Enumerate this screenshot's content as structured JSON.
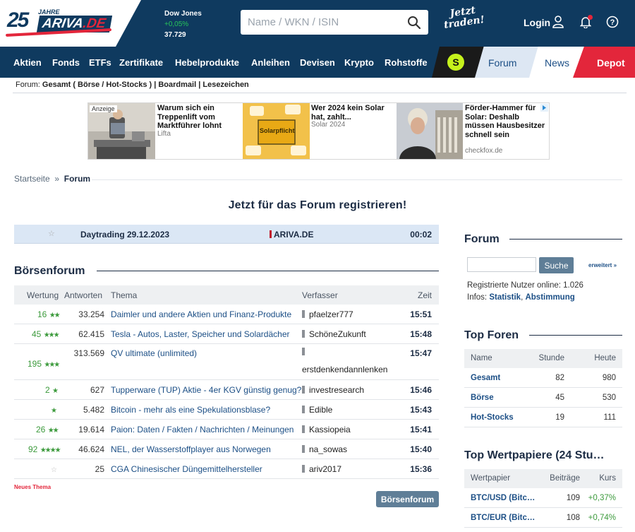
{
  "header": {
    "logo_num": "25",
    "logo_jahre": "JAHRE",
    "logo_ariva": "ARIVA",
    "logo_de": ".DE",
    "ticker": {
      "name": "Dow Jones",
      "change": "+0,05%",
      "value": "37.729"
    },
    "search_placeholder": "Name / WKN / ISIN",
    "traden_1": "Jetzt",
    "traden_2": "traden!",
    "login": "Login"
  },
  "nav": {
    "items": [
      "Aktien",
      "Fonds",
      "ETFs",
      "Zertifikate",
      "Hebelprodukte",
      "Anleihen",
      "Devisen",
      "Krypto",
      "Rohstoffe"
    ],
    "s_logo": "S",
    "forum": "Forum",
    "news": "News",
    "depot": "Depot"
  },
  "subnav": {
    "prefix": "Forum: ",
    "gesamt": "Gesamt",
    "paren": " ( Börse / Hot-Stocks ) | ",
    "boardmail": "Boardmail",
    "sep": " | ",
    "lesezeichen": "Lesezeichen"
  },
  "ads": {
    "label": "Anzeige",
    "items": [
      {
        "title": "Warum sich ein Treppenlift vom Marktführer lohnt",
        "source": "Lifta"
      },
      {
        "title": "Wer 2024 kein Solar hat, zahlt...",
        "source": "Solar 2024",
        "sign": "Solarpflicht"
      },
      {
        "title": "Förder-Hammer für Solar: Deshalb müssen Hausbesitzer schnell sein",
        "source": "checkfox.de"
      }
    ]
  },
  "breadcrumb": {
    "home": "Startseite",
    "sep": "»",
    "current": "Forum"
  },
  "register": "Jetzt für das Forum registrieren!",
  "featured": {
    "title": "Daytrading 29.12.2023",
    "source": "ARIVA.DE",
    "time": "00:02"
  },
  "boersenforum": {
    "title": "Börsenforum",
    "columns": {
      "rating": "Wertung",
      "answers": "Antworten",
      "topic": "Thema",
      "author": "Verfasser",
      "time": "Zeit"
    },
    "rows": [
      {
        "rating": "16",
        "stars": "★★",
        "answers": "33.254",
        "topic": "Daimler und andere Aktien und Finanz-Produkte",
        "author": "pfaelzer777",
        "time": "15:51"
      },
      {
        "rating": "45",
        "stars": "★★★",
        "answers": "62.415",
        "topic": "Tesla - Autos, Laster, Speicher und Solardächer",
        "author": "SchöneZukunft",
        "time": "15:48"
      },
      {
        "rating": "195",
        "stars": "★★★",
        "answers": "313.569",
        "topic": "QV ultimate (unlimited)",
        "author": "erstdenkendannlenken",
        "time": "15:47"
      },
      {
        "rating": "2",
        "stars": "★",
        "answers": "627",
        "topic": "Tupperware (TUP) Aktie - 4er KGV günstig genug?",
        "author": "investresearch",
        "time": "15:46"
      },
      {
        "rating": "",
        "stars": "★",
        "answers": "5.482",
        "topic": "Bitcoin - mehr als eine Spekulationsblase?",
        "author": "Edible",
        "time": "15:43"
      },
      {
        "rating": "26",
        "stars": "★★",
        "answers": "19.614",
        "topic": "Paion: Daten / Fakten / Nachrichten / Meinungen",
        "author": "Kassiopeia",
        "time": "15:41"
      },
      {
        "rating": "92",
        "stars": "★★★★",
        "answers": "46.624",
        "topic": "NEL, der Wasserstoffplayer aus Norwegen",
        "author": "na_sowas",
        "time": "15:40"
      },
      {
        "rating": "",
        "stars": "☆",
        "answers": "25",
        "topic": "CGA Chinesischer Düngemittelhersteller",
        "author": "ariv2017",
        "time": "15:36"
      }
    ],
    "new_topic": "Neues Thema",
    "button": "Börsenforum"
  },
  "sidebar": {
    "forum_title": "Forum",
    "search_button": "Suche",
    "erweitert": "erweitert »",
    "online": "Registrierte Nutzer online: 1.026",
    "infos_prefix": "Infos: ",
    "statistik": "Statistik",
    "infos_sep": ", ",
    "abstimmung": "Abstimmung",
    "top_foren": {
      "title": "Top Foren",
      "columns": {
        "name": "Name",
        "hour": "Stunde",
        "today": "Heute"
      },
      "rows": [
        {
          "name": "Gesamt",
          "hour": "82",
          "today": "980"
        },
        {
          "name": "Börse",
          "hour": "45",
          "today": "530"
        },
        {
          "name": "Hot-Stocks",
          "hour": "19",
          "today": "111"
        }
      ]
    },
    "top_wertpapiere": {
      "title": "Top Wertpapiere (24 Stu…",
      "columns": {
        "security": "Wertpapier",
        "posts": "Beiträge",
        "price": "Kurs"
      },
      "rows": [
        {
          "name": "BTC/USD (Bitc…",
          "posts": "109",
          "price": "+0,37%"
        },
        {
          "name": "BTC/EUR (Bitc…",
          "posts": "108",
          "price": "+0,74%"
        }
      ]
    }
  }
}
